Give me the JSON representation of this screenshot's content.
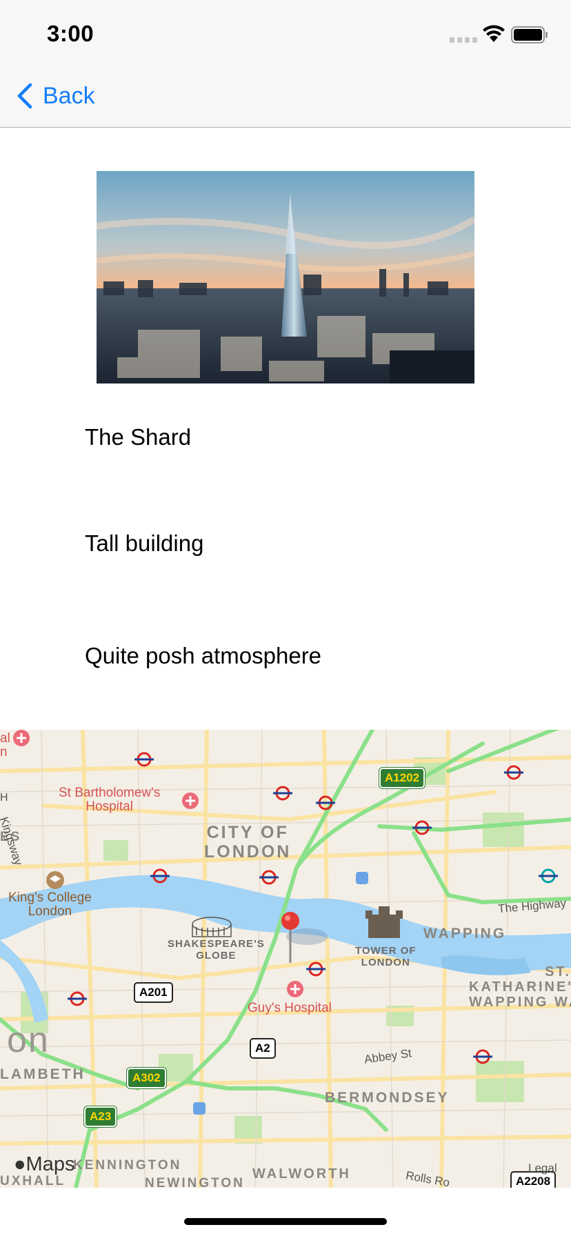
{
  "status_bar": {
    "time": "3:00"
  },
  "nav": {
    "back_label": "Back"
  },
  "content": {
    "title": "The Shard",
    "description": "Tall building",
    "atmosphere": "Quite posh atmosphere"
  },
  "map": {
    "labels": {
      "city_of_london_1": "CITY OF",
      "city_of_london_2": "LONDON",
      "st_barts_1": "St Bartholomew's",
      "st_barts_2": "Hospital",
      "kings_college_1": "King's College",
      "kings_college_2": "London",
      "globe_1": "SHAKESPEARE'S",
      "globe_2": "GLOBE",
      "tower_1": "TOWER OF",
      "tower_2": "LONDON",
      "wapping": "WAPPING",
      "st_katharine_1": "ST.",
      "st_katharine_2": "KATHARINE'S",
      "st_katharine_3": "WAPPING WA",
      "guys": "Guy's Hospital",
      "lambeth": "LAMBETH",
      "bermondsey": "BERMONDSEY",
      "kennington": "KENNINGTON",
      "newington": "NEWINGTON",
      "walworth": "WALWORTH",
      "vauxhall": "UXHALL",
      "on": "on",
      "es": "ES",
      "kingsway": "Kingsway",
      "the_highway": "The Highway",
      "abbey_st": "Abbey St",
      "rolls_rd": "Rolls Ro",
      "al": "al",
      "n_left": "n",
      "h_left": "H"
    },
    "shields": {
      "a1202": "A1202",
      "a201": "A201",
      "a2": "A2",
      "a302": "A302",
      "a23": "A23",
      "a2208": "A2208"
    },
    "logo": "Maps",
    "legal": "Legal"
  },
  "colors": {
    "accent": "#147efb",
    "map_background": "#f4efe6",
    "river": "#a3d3f5",
    "park": "#c8e6b0",
    "major_road": "#8be08a",
    "minor_road": "#fbe3a3",
    "pin": "#e53935"
  }
}
